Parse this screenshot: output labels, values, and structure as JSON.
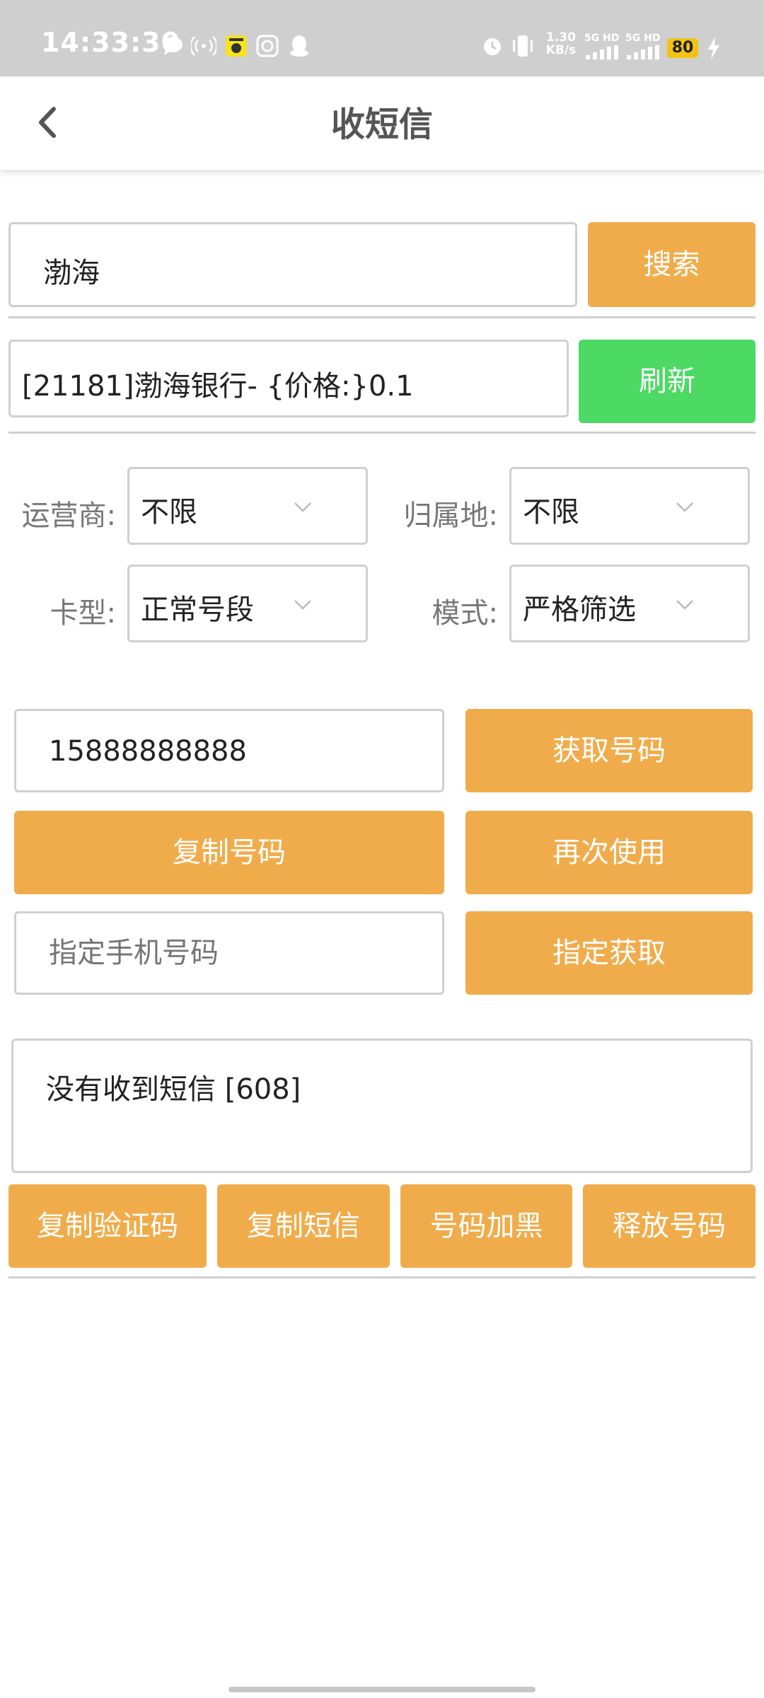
{
  "status_bar": {
    "time": "14:33:30",
    "speed_value": "1.30",
    "speed_unit": "KB/s",
    "net1": "5G HD",
    "net2": "5G HD",
    "battery": "80",
    "icons": [
      "message-icon",
      "hotspot-icon",
      "app-badge-icon",
      "sync-icon",
      "qq-icon",
      "alarm-icon",
      "vibrate-icon",
      "charging-icon"
    ]
  },
  "header": {
    "title": "收短信"
  },
  "search": {
    "value": "渤海",
    "button": "搜索"
  },
  "project": {
    "value": "[21181]渤海银行- {价格:}0.1",
    "refresh": "刷新"
  },
  "filters": {
    "operator_label": "运营商:",
    "operator_value": "不限",
    "region_label": "归属地:",
    "region_value": "不限",
    "card_label": "卡型:",
    "card_value": "正常号段",
    "mode_label": "模式:",
    "mode_value": "严格筛选"
  },
  "phone": {
    "value": "15888888888",
    "get_button": "获取号码",
    "copy_button": "复制号码",
    "reuse_button": "再次使用",
    "specify_placeholder": "指定手机号码",
    "specify_button": "指定获取"
  },
  "sms": {
    "message": "没有收到短信 [608]",
    "copy_code": "复制验证码",
    "copy_sms": "复制短信",
    "blacklist": "号码加黑",
    "release": "释放号码"
  },
  "colors": {
    "accent": "#f0ac4b",
    "refresh": "#4cd964",
    "statusbar": "#cfcfcf"
  }
}
